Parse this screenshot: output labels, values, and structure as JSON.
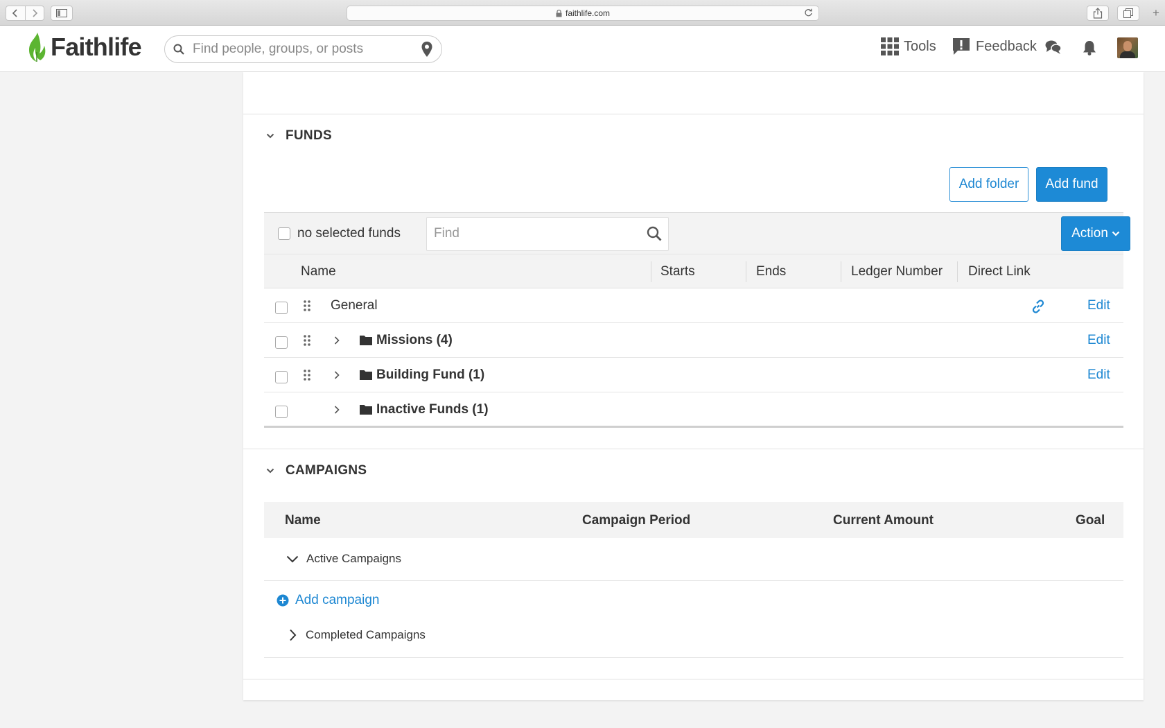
{
  "browser": {
    "url": "faithlife.com"
  },
  "header": {
    "logo_text": "Faithlife",
    "search_placeholder": "Find people, groups, or posts",
    "tools_label": "Tools",
    "feedback_label": "Feedback"
  },
  "funds": {
    "title": "FUNDS",
    "add_folder_label": "Add folder",
    "add_fund_label": "Add fund",
    "selection_label": "no selected funds",
    "find_placeholder": "Find",
    "action_label": "Action",
    "columns": [
      "Name",
      "Starts",
      "Ends",
      "Ledger Number",
      "Direct Link"
    ],
    "rows": [
      {
        "name": "General",
        "type": "fund",
        "edit_label": "Edit",
        "has_direct_link": true
      },
      {
        "name": "Missions (4)",
        "type": "folder",
        "edit_label": "Edit"
      },
      {
        "name": "Building Fund (1)",
        "type": "folder",
        "edit_label": "Edit"
      },
      {
        "name": "Inactive Funds (1)",
        "type": "folder"
      }
    ]
  },
  "campaigns": {
    "title": "CAMPAIGNS",
    "columns": [
      "Name",
      "Campaign Period",
      "Current Amount",
      "Goal"
    ],
    "active_group_label": "Active Campaigns",
    "add_campaign_label": "Add campaign",
    "completed_group_label": "Completed Campaigns"
  },
  "colors": {
    "accent": "#1d8ad6",
    "logo_green": "#5cb531",
    "page_background": "#f3f3f3"
  },
  "icons": [
    "back-icon",
    "forward-icon",
    "sidebar-icon",
    "lock-icon",
    "reload-icon",
    "share-icon",
    "tabs-icon",
    "faithlife-leaf-icon",
    "search-icon",
    "location-pin-icon",
    "grid-icon",
    "feedback-icon",
    "chat-icon",
    "bell-icon",
    "chevron-down-icon",
    "drag-handle-icon",
    "chevron-right-icon",
    "folder-icon",
    "link-icon",
    "plus-circle-icon"
  ]
}
